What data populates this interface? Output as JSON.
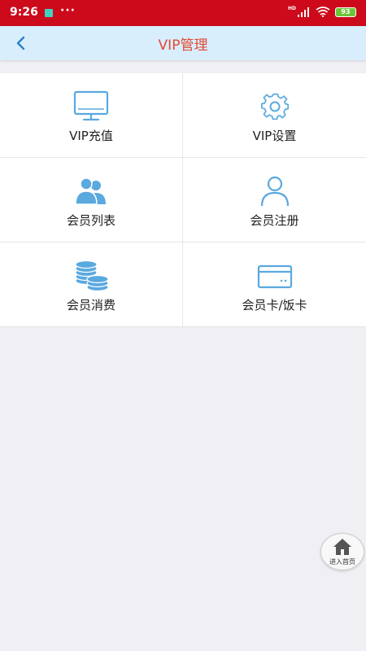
{
  "status_bar": {
    "time": "9:26",
    "dots": "···",
    "network_label": "HD",
    "battery": "93"
  },
  "header": {
    "title": "VIP管理"
  },
  "menu": [
    {
      "label": "VIP充值",
      "icon": "monitor-icon"
    },
    {
      "label": "VIP设置",
      "icon": "gear-icon"
    },
    {
      "label": "会员列表",
      "icon": "users-icon"
    },
    {
      "label": "会员注册",
      "icon": "user-icon"
    },
    {
      "label": "会员消费",
      "icon": "coins-icon"
    },
    {
      "label": "会员卡/饭卡",
      "icon": "card-icon"
    }
  ],
  "home_button": {
    "label": "进入首页"
  },
  "colors": {
    "status_bar": "#cc0a1b",
    "header_bg": "#d8eefc",
    "title": "#e44934",
    "icon_blue": "#5aa9df"
  }
}
